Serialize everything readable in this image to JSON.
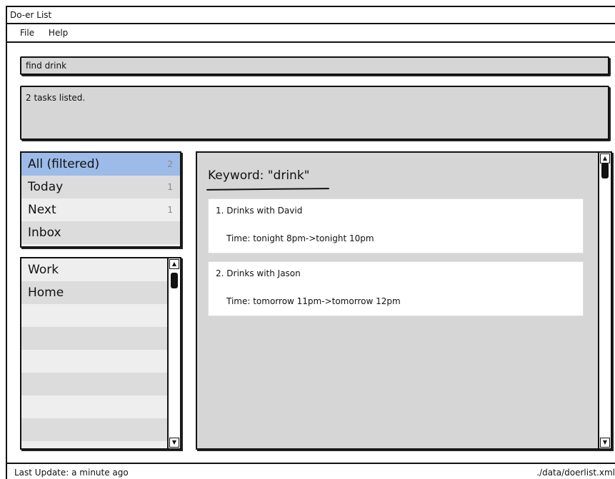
{
  "window": {
    "title": "Do-er List"
  },
  "menu": {
    "items": [
      "File",
      "Help"
    ]
  },
  "command": {
    "value": "find drink"
  },
  "result": {
    "message": "2 tasks listed."
  },
  "filters": [
    {
      "label": "All (filtered)",
      "count": "2"
    },
    {
      "label": "Today",
      "count": "1"
    },
    {
      "label": "Next",
      "count": "1"
    },
    {
      "label": "Inbox",
      "count": ""
    }
  ],
  "tags": [
    "Work",
    "Home"
  ],
  "task_panel": {
    "keyword": "Keyword: \"drink\"",
    "tasks": [
      {
        "name": "1. Drinks with David",
        "time": "Time: tonight 8pm->tonight 10pm"
      },
      {
        "name": "2. Drinks with Jason",
        "time": "Time: tomorrow 11pm->tomorrow 12pm"
      }
    ]
  },
  "status": {
    "last_update": "Last Update: a minute ago",
    "file_path": "./data/doerlist.xml"
  },
  "colors": {
    "selected": "#9dbbe8",
    "panel": "#d6d6d6",
    "row_alt": "#dcdcdc"
  }
}
